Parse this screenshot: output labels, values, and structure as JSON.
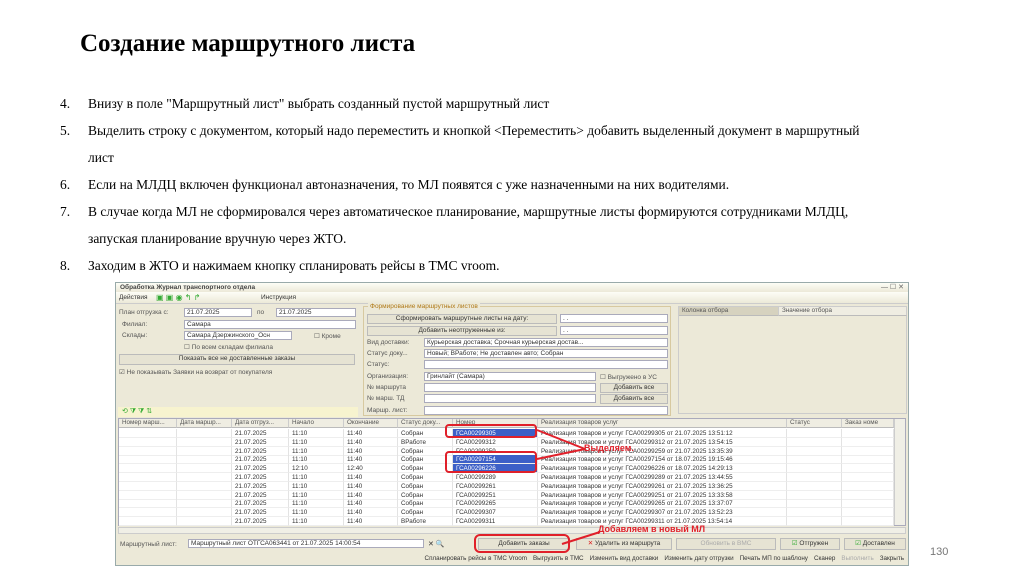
{
  "title": "Создание маршрутного листа",
  "steps": [
    {
      "num": "4.",
      "text": "Внизу в поле \"Маршрутный лист\" выбрать созданный пустой маршрутный лист"
    },
    {
      "num": "5.",
      "text": "Выделить строку с документом, который надо переместить и кнопкой <Переместить> добавить выделенный документ в маршрутный",
      "cont": "лист"
    },
    {
      "num": "6.",
      "text": "Если на МЛДЦ включен функционал автоназначения, то МЛ появятся с уже назначенными на них водителями."
    },
    {
      "num": "7.",
      "text": "В случае когда МЛ не сформировался через автоматическое планирование, маршрутные листы формируются сотрудниками МЛДЦ,",
      "cont": "запуская планирование вручную через ЖТО."
    },
    {
      "num": "8.",
      "text": "Заходим в ЖТО и нажимаем кнопку спланировать рейсы в ТМС vroom."
    }
  ],
  "page_number": "130",
  "window": {
    "title": "Обработка  Журнал транспортного отдела",
    "toolbar": {
      "actions": "Действия",
      "help": "Инструкция"
    },
    "left": {
      "plan_label": "План отгрузка с:",
      "date_from": "21.07.2025",
      "to_label": "по",
      "date_to": "21.07.2025",
      "branch_label": "Филиал:",
      "branch": "Самара",
      "warehouses_label": "Склады:",
      "warehouses": "Самара Дзержинского_Осн",
      "except": "Кроме",
      "all_warehouses": "По всем складам филиала",
      "show_button": "Показать все не доставленные заказы",
      "hide_returns": "Не показывать Заявки на возврат от покупателя"
    },
    "formation": {
      "group_title": "Формирование маршрутных листов",
      "form_button": "Сформировать маршрутные листы на дату:",
      "form_date": " .  .",
      "add_button": "Добавить неотгруженные из:",
      "add_date": " .  .",
      "delivery_label": "Вид доставки:",
      "delivery": "Курьерская доставка; Срочная курьерская достав...",
      "docstatus_label": "Статус доку...",
      "docstatus": "Новый; ВРаботе; Не доставлен авто; Собран",
      "status_label": "Статус:",
      "status": "",
      "org_label": "Организация:",
      "org": "Гринлайт (Самара)",
      "exported": "Выгружено в УС",
      "route_label": "№ маршрута",
      "route": "",
      "add_all1": "Добавить все",
      "route_td_label": "№ марш. ТД",
      "route_td": "",
      "add_all2": "Добавить все",
      "route_sheet_label": "Маршр. лист:",
      "route_sheet": ""
    },
    "filter": {
      "col1": "Колонка отбора",
      "col2": "Значение отбора"
    },
    "table": {
      "columns": [
        "Номер марш...",
        "Дата маршр...",
        "Дата отгруз...",
        "Начало",
        "Окончание",
        "Статус доку...",
        "Номер",
        "Реализация товаров услуг",
        "Статус",
        "Заказ номе"
      ],
      "rows": [
        [
          "",
          "",
          "21.07.2025",
          "11:10",
          "11:40",
          "Собран",
          "ГСА00299305",
          "Реализация товаров и услуг ГСА00299305 от 21.07.2025 13:51:12",
          "",
          ""
        ],
        [
          "",
          "",
          "21.07.2025",
          "11:10",
          "11:40",
          "ВРаботе",
          "ГСА00299312",
          "Реализация товаров и услуг ГСА00299312 от 21.07.2025 13:54:15",
          "",
          ""
        ],
        [
          "",
          "",
          "21.07.2025",
          "11:10",
          "11:40",
          "Собран",
          "ГСА00299259",
          "Реализация товаров и услуг ГСА00299259 от 21.07.2025 13:35:39",
          "",
          ""
        ],
        [
          "",
          "",
          "21.07.2025",
          "11:10",
          "11:40",
          "Собран",
          "ГСА00297154",
          "Реализация товаров и услуг ГСА00297154 от 18.07.2025 19:15:46",
          "",
          ""
        ],
        [
          "",
          "",
          "21.07.2025",
          "12:10",
          "12:40",
          "Собран",
          "ГСА00296226",
          "Реализация товаров и услуг ГСА00296226 от 18.07.2025 14:29:13",
          "",
          ""
        ],
        [
          "",
          "",
          "21.07.2025",
          "11:10",
          "11:40",
          "Собран",
          "ГСА00299289",
          "Реализация товаров и услуг ГСА00299289 от 21.07.2025 13:44:55",
          "",
          ""
        ],
        [
          "",
          "",
          "21.07.2025",
          "11:10",
          "11:40",
          "Собран",
          "ГСА00299261",
          "Реализация товаров и услуг ГСА00299261 от 21.07.2025 13:36:25",
          "",
          ""
        ],
        [
          "",
          "",
          "21.07.2025",
          "11:10",
          "11:40",
          "Собран",
          "ГСА00299251",
          "Реализация товаров и услуг ГСА00299251 от 21.07.2025 13:33:58",
          "",
          ""
        ],
        [
          "",
          "",
          "21.07.2025",
          "11:10",
          "11:40",
          "Собран",
          "ГСА00299265",
          "Реализация товаров и услуг ГСА00299265 от 21.07.2025 13:37:07",
          "",
          ""
        ],
        [
          "",
          "",
          "21.07.2025",
          "11:10",
          "11:40",
          "Собран",
          "ГСА00299307",
          "Реализация товаров и услуг ГСА00299307 от 21.07.2025 13:52:23",
          "",
          ""
        ],
        [
          "",
          "",
          "21.07.2025",
          "11:10",
          "11:40",
          "ВРаботе",
          "ГСА00299311",
          "Реализация товаров и услуг ГСА00299311 от 21.07.2025 13:54:14",
          "",
          ""
        ]
      ],
      "selected_rows": [
        0,
        3,
        4
      ]
    },
    "bottom": {
      "route_sheet_label": "Маршрутный лист:",
      "route_sheet": "Маршрутный лист ОТГСА063441 от 21.07.2025 14:00:54",
      "add_orders": "Добавить заказы",
      "remove": "Удалить из маршрута",
      "update_wms": "Обновить в ВМС",
      "shipped": "Отгружен",
      "delivered": "Доставлен"
    },
    "commands": [
      "Спланировать рейсы в ТМС Vroom",
      "Выгрузить в ТМС",
      "Изменить вид доставки",
      "Изменить дату отгрузки",
      "Печать МП по шаблону",
      "Сканер",
      "Выполнить",
      "Закрыть"
    ]
  },
  "annotations": {
    "select": "Выделяем.",
    "add": "Добавляем в новый МЛ",
    "color": "#e0202a"
  }
}
